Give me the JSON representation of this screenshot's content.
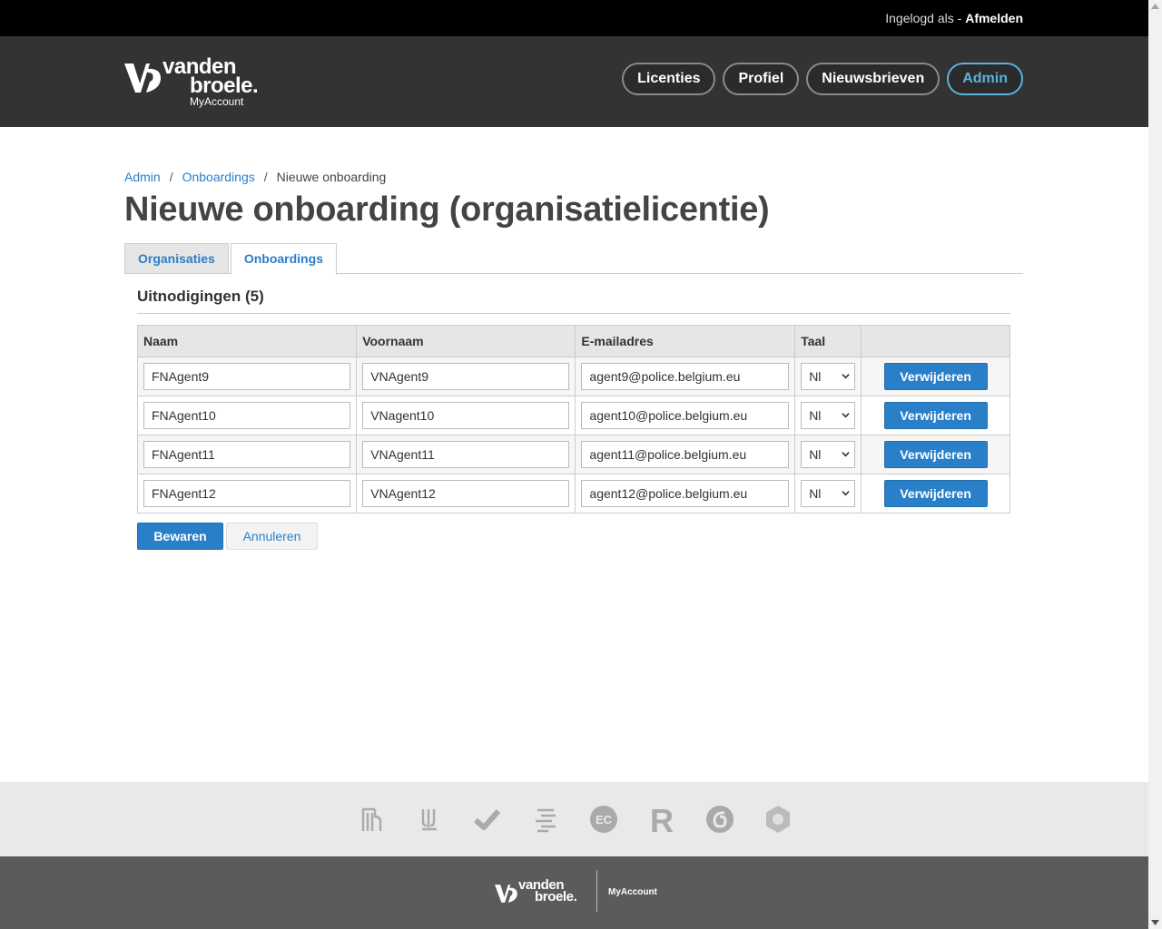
{
  "topbar": {
    "logged_in_prefix": "Ingelogd als - ",
    "logout": "Afmelden"
  },
  "logo": {
    "line1": "vanden",
    "line2": "broele.",
    "sub": "MyAccount"
  },
  "nav": [
    {
      "label": "Licenties",
      "active": false
    },
    {
      "label": "Profiel",
      "active": false
    },
    {
      "label": "Nieuwsbrieven",
      "active": false
    },
    {
      "label": "Admin",
      "active": true
    }
  ],
  "breadcrumb": {
    "item1": "Admin",
    "item2": "Onboardings",
    "current": "Nieuwe onboarding",
    "sep": "/"
  },
  "page_title": "Nieuwe onboarding (organisatielicentie)",
  "tabs": {
    "organisaties": "Organisaties",
    "onboardings": "Onboardings"
  },
  "section_title": "Uitnodigingen (5)",
  "table": {
    "headers": {
      "naam": "Naam",
      "voornaam": "Voornaam",
      "email": "E-mailadres",
      "taal": "Taal"
    },
    "rows": [
      {
        "naam": "FNAgent9",
        "voornaam": "VNAgent9",
        "email": "agent9@police.belgium.eu",
        "taal": "Nl"
      },
      {
        "naam": "FNAgent10",
        "voornaam": "VNagent10",
        "email": "agent10@police.belgium.eu",
        "taal": "Nl"
      },
      {
        "naam": "FNAgent11",
        "voornaam": "VNAgent11",
        "email": "agent11@police.belgium.eu",
        "taal": "Nl"
      },
      {
        "naam": "FNAgent12",
        "voornaam": "VNAgent12",
        "email": "agent12@police.belgium.eu",
        "taal": "Nl"
      }
    ],
    "delete_label": "Verwijderen"
  },
  "actions": {
    "save": "Bewaren",
    "cancel": "Annuleren"
  },
  "footer": {
    "line1": "vanden",
    "line2": "broele.",
    "myaccount": "MyAccount"
  },
  "brand_icons": [
    "brand-1-icon",
    "brand-2-icon",
    "brand-3-icon",
    "brand-4-icon",
    "brand-ec-icon",
    "brand-r-icon",
    "brand-6-icon",
    "brand-7-icon"
  ],
  "brand_text": {
    "ec": "EC",
    "r": "R"
  },
  "colors": {
    "primary": "#2a80c8",
    "link": "#2a7fc9",
    "header_bg": "#333333",
    "active_nav": "#5ab3de",
    "footer_bg": "#5c5a5c"
  }
}
